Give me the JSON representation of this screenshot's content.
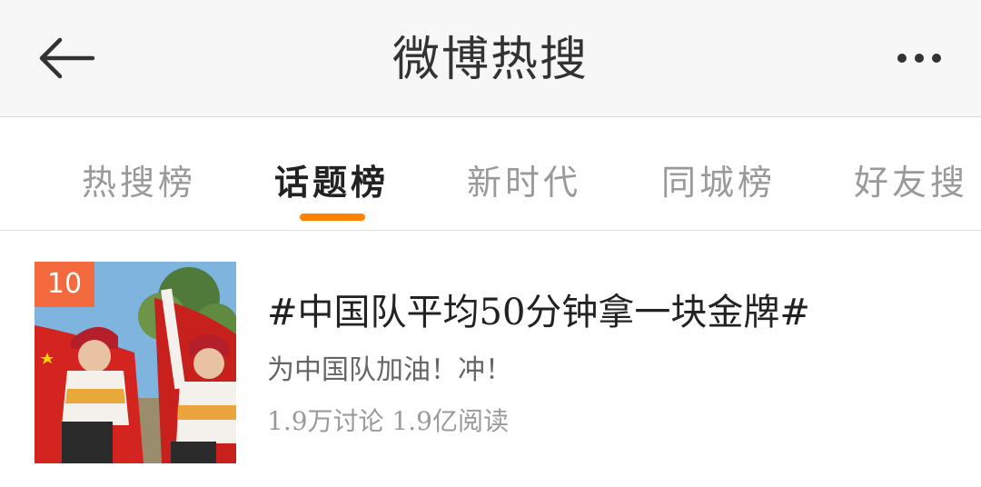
{
  "header": {
    "title": "微博热搜",
    "back_icon": "back-arrow-icon",
    "more_icon": "more-dots-icon"
  },
  "tabs": [
    {
      "label": "热搜榜",
      "active": false
    },
    {
      "label": "话题榜",
      "active": true
    },
    {
      "label": "新时代",
      "active": false
    },
    {
      "label": "同城榜",
      "active": false
    },
    {
      "label": "好友搜",
      "active": false
    }
  ],
  "colors": {
    "accent": "#ff8200",
    "rank_badge": "#f26a3d",
    "header_bg": "#f7f7f7"
  },
  "topic": {
    "rank": "10",
    "title": "#中国队平均50分钟拿一块金牌#",
    "description": "为中国队加油！冲！",
    "stats": "1.9万讨论 1.9亿阅读"
  }
}
